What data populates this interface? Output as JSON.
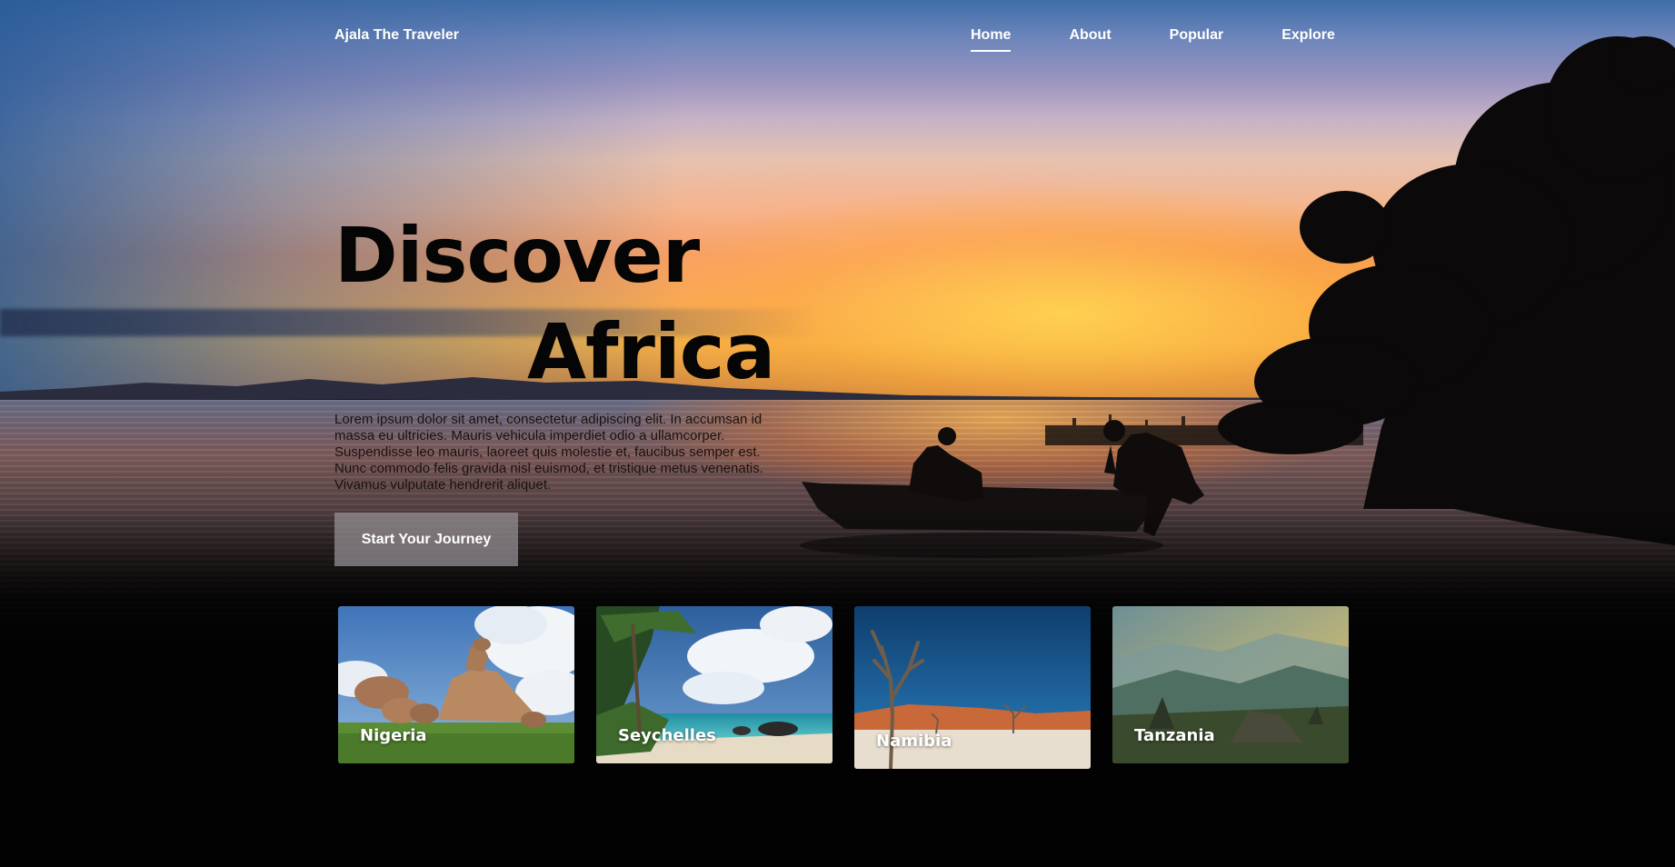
{
  "brand": {
    "name": "Ajala The Traveler"
  },
  "nav": {
    "items": [
      {
        "label": "Home",
        "active": true
      },
      {
        "label": "About",
        "active": false
      },
      {
        "label": "Popular",
        "active": false
      },
      {
        "label": "Explore",
        "active": false
      }
    ]
  },
  "hero": {
    "title_line1": "Discover",
    "title_line2": "Africa",
    "description": "Lorem ipsum dolor sit amet, consectetur adipiscing elit. In accumsan id massa eu ultricies. Mauris vehicula imperdiet odio a ullamcorper. Suspendisse leo mauris, laoreet quis molestie et, faucibus semper est. Nunc commodo felis gravida nisl euismod, et tristique metus venenatis. Vivamus vulputate hendrerit aliquet.",
    "cta_label": "Start Your Journey"
  },
  "destinations": [
    {
      "name": "Nigeria"
    },
    {
      "name": "Seychelles"
    },
    {
      "name": "Namibia"
    },
    {
      "name": "Tanzania"
    }
  ],
  "colors": {
    "nav_text": "#ffffff",
    "headline_text": "#050505",
    "cta_background": "#96919a",
    "page_background": "#020202"
  }
}
